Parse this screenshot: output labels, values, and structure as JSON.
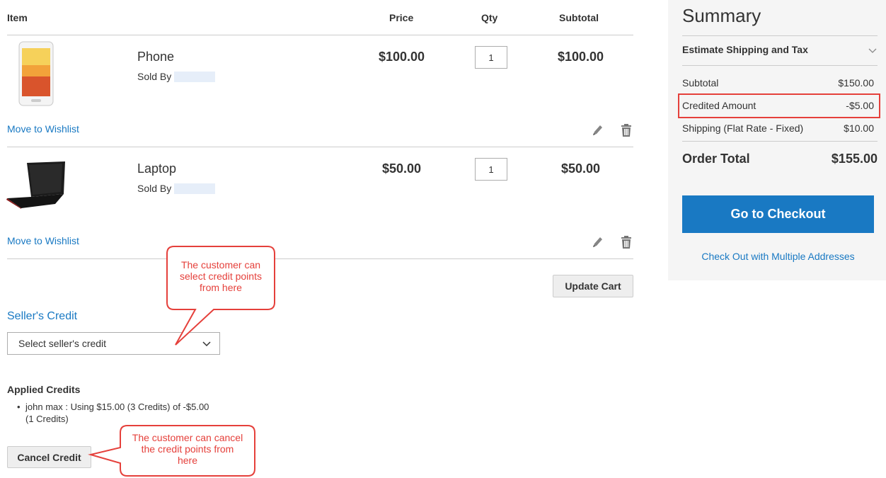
{
  "cart": {
    "headers": {
      "item": "Item",
      "price": "Price",
      "qty": "Qty",
      "subtotal": "Subtotal"
    },
    "items": [
      {
        "name": "Phone",
        "sold_by": "Sold By",
        "price": "$100.00",
        "qty": "1",
        "subtotal": "$100.00",
        "move_to_wishlist": "Move to Wishlist"
      },
      {
        "name": "Laptop",
        "sold_by": "Sold By",
        "price": "$50.00",
        "qty": "1",
        "subtotal": "$50.00",
        "move_to_wishlist": "Move to Wishlist"
      }
    ],
    "update_cart_label": "Update Cart"
  },
  "seller_credit": {
    "title": "Seller's Credit",
    "select_placeholder": "Select seller's credit"
  },
  "applied_credits": {
    "title": "Applied Credits",
    "items": [
      "john max : Using $15.00 (3 Credits) of -$5.00 (1 Credits)"
    ],
    "cancel_label": "Cancel Credit"
  },
  "callouts": {
    "select": "The customer can select credit points from here",
    "cancel": "The customer can cancel the credit points from here",
    "color": "#e5403b"
  },
  "summary": {
    "title": "Summary",
    "estimate_label": "Estimate Shipping and Tax",
    "rows": [
      {
        "label": "Subtotal",
        "value": "$150.00"
      },
      {
        "label": "Credited Amount",
        "value": "-$5.00"
      },
      {
        "label": "Shipping (Flat Rate - Fixed)",
        "value": "$10.00"
      }
    ],
    "order_total_label": "Order Total",
    "order_total_value": "$155.00",
    "checkout_label": "Go to Checkout",
    "multi_address_label": "Check Out with Multiple Addresses"
  },
  "icons": {
    "edit": "pencil-icon",
    "delete": "trash-icon",
    "dropdown": "chevron-down-icon"
  },
  "colors": {
    "link": "#1979c3",
    "primary_button": "#1979c3",
    "highlight": "#e5403b"
  }
}
